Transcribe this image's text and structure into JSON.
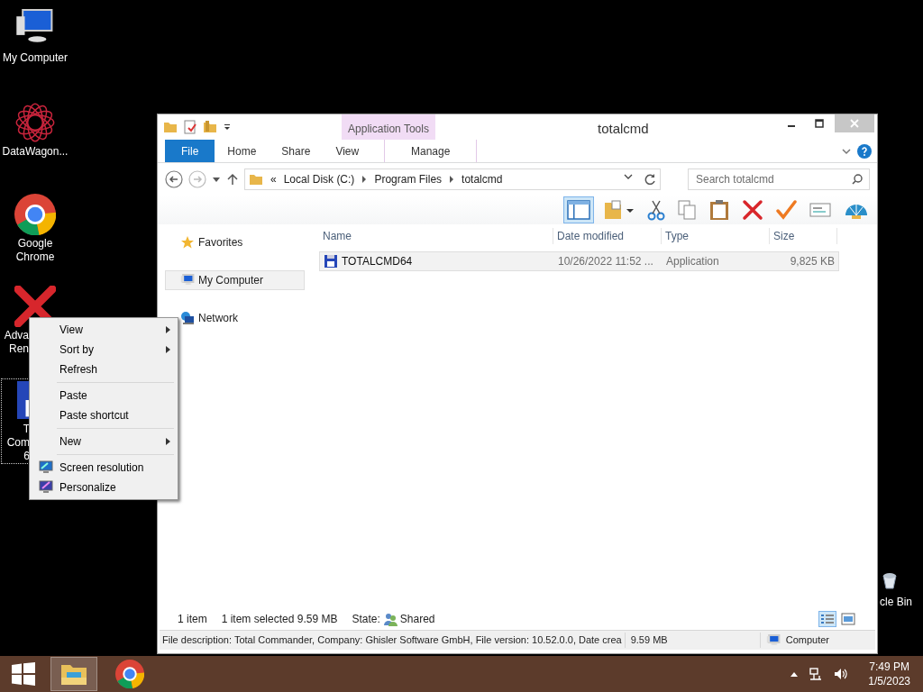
{
  "desktop_icons": [
    {
      "kind": "computer",
      "label_lines": [
        "My Computer"
      ],
      "covered": false,
      "selected": false
    },
    {
      "kind": "star",
      "label_lines": [
        "DataWagon..."
      ],
      "covered": false,
      "selected": false
    },
    {
      "kind": "chrome",
      "label_lines": [
        "Google",
        "Chrome"
      ],
      "covered": false,
      "selected": false
    },
    {
      "kind": "cross",
      "label_lines": [
        "Adva",
        "Ren"
      ],
      "covered": true,
      "selected": false
    },
    {
      "kind": "disk",
      "label_lines": [
        "T",
        "Com",
        "6"
      ],
      "covered": true,
      "selected": true
    },
    {
      "kind": "bin",
      "label_lines": [
        "cle Bin"
      ],
      "covered": true,
      "selected": false
    }
  ],
  "window": {
    "title": "totalcmd",
    "contextual_group": "Application Tools",
    "ribbon_tabs": [
      {
        "label": "File",
        "kind": "file",
        "selected": false
      },
      {
        "label": "Home",
        "kind": "tab",
        "selected": false
      },
      {
        "label": "Share",
        "kind": "tab",
        "selected": false
      },
      {
        "label": "View",
        "kind": "tab",
        "selected": false
      },
      {
        "label": "Manage",
        "kind": "contextual",
        "selected": false
      }
    ],
    "address": {
      "overflow": "«",
      "crumbs": [
        "Local Disk (C:)",
        "Program Files",
        "totalcmd"
      ]
    },
    "search": {
      "placeholder": "Search totalcmd"
    },
    "preview_pane": {
      "selected": true
    },
    "navigation": [
      {
        "label": "Favorites",
        "kind": "star",
        "selected": false
      },
      {
        "label": "My Computer",
        "kind": "computer",
        "selected": true
      },
      {
        "label": "Network",
        "kind": "network",
        "selected": false
      }
    ],
    "columns": [
      "Name",
      "Date modified",
      "Type",
      "Size"
    ],
    "rows": [
      {
        "name": "TOTALCMD64",
        "date_modified": "10/26/2022 11:52 ...",
        "type": "Application",
        "size": "9,825 KB",
        "selected": true
      }
    ],
    "status_bar": {
      "count": "1 item",
      "selection": "1 item selected  9.59 MB",
      "state_label": "State:",
      "state": "Shared",
      "views": [
        {
          "kind": "details",
          "selected": true
        },
        {
          "kind": "large",
          "selected": false
        }
      ]
    },
    "details_bar": {
      "description": "File description: Total Commander, Company: Ghisler Software GmbH, File version: 10.52.0.0, Date crea",
      "size": "9.59 MB",
      "zone": "Computer"
    }
  },
  "context_menu": [
    {
      "kind": "item",
      "label": "View",
      "submenu": true
    },
    {
      "kind": "item",
      "label": "Sort by",
      "submenu": true
    },
    {
      "kind": "item",
      "label": "Refresh",
      "submenu": false
    },
    {
      "kind": "separator"
    },
    {
      "kind": "item",
      "label": "Paste",
      "submenu": false
    },
    {
      "kind": "item",
      "label": "Paste shortcut",
      "submenu": false
    },
    {
      "kind": "separator"
    },
    {
      "kind": "item",
      "label": "New",
      "submenu": true
    },
    {
      "kind": "separator"
    },
    {
      "kind": "display",
      "label": "Screen resolution",
      "submenu": false
    },
    {
      "kind": "personalize",
      "label": "Personalize",
      "submenu": false
    }
  ],
  "taskbar": {
    "apps": [
      {
        "kind": "explorer",
        "active": true
      },
      {
        "kind": "chrome",
        "active": false
      }
    ],
    "time": "7:49 PM",
    "date": "1/5/2023"
  }
}
